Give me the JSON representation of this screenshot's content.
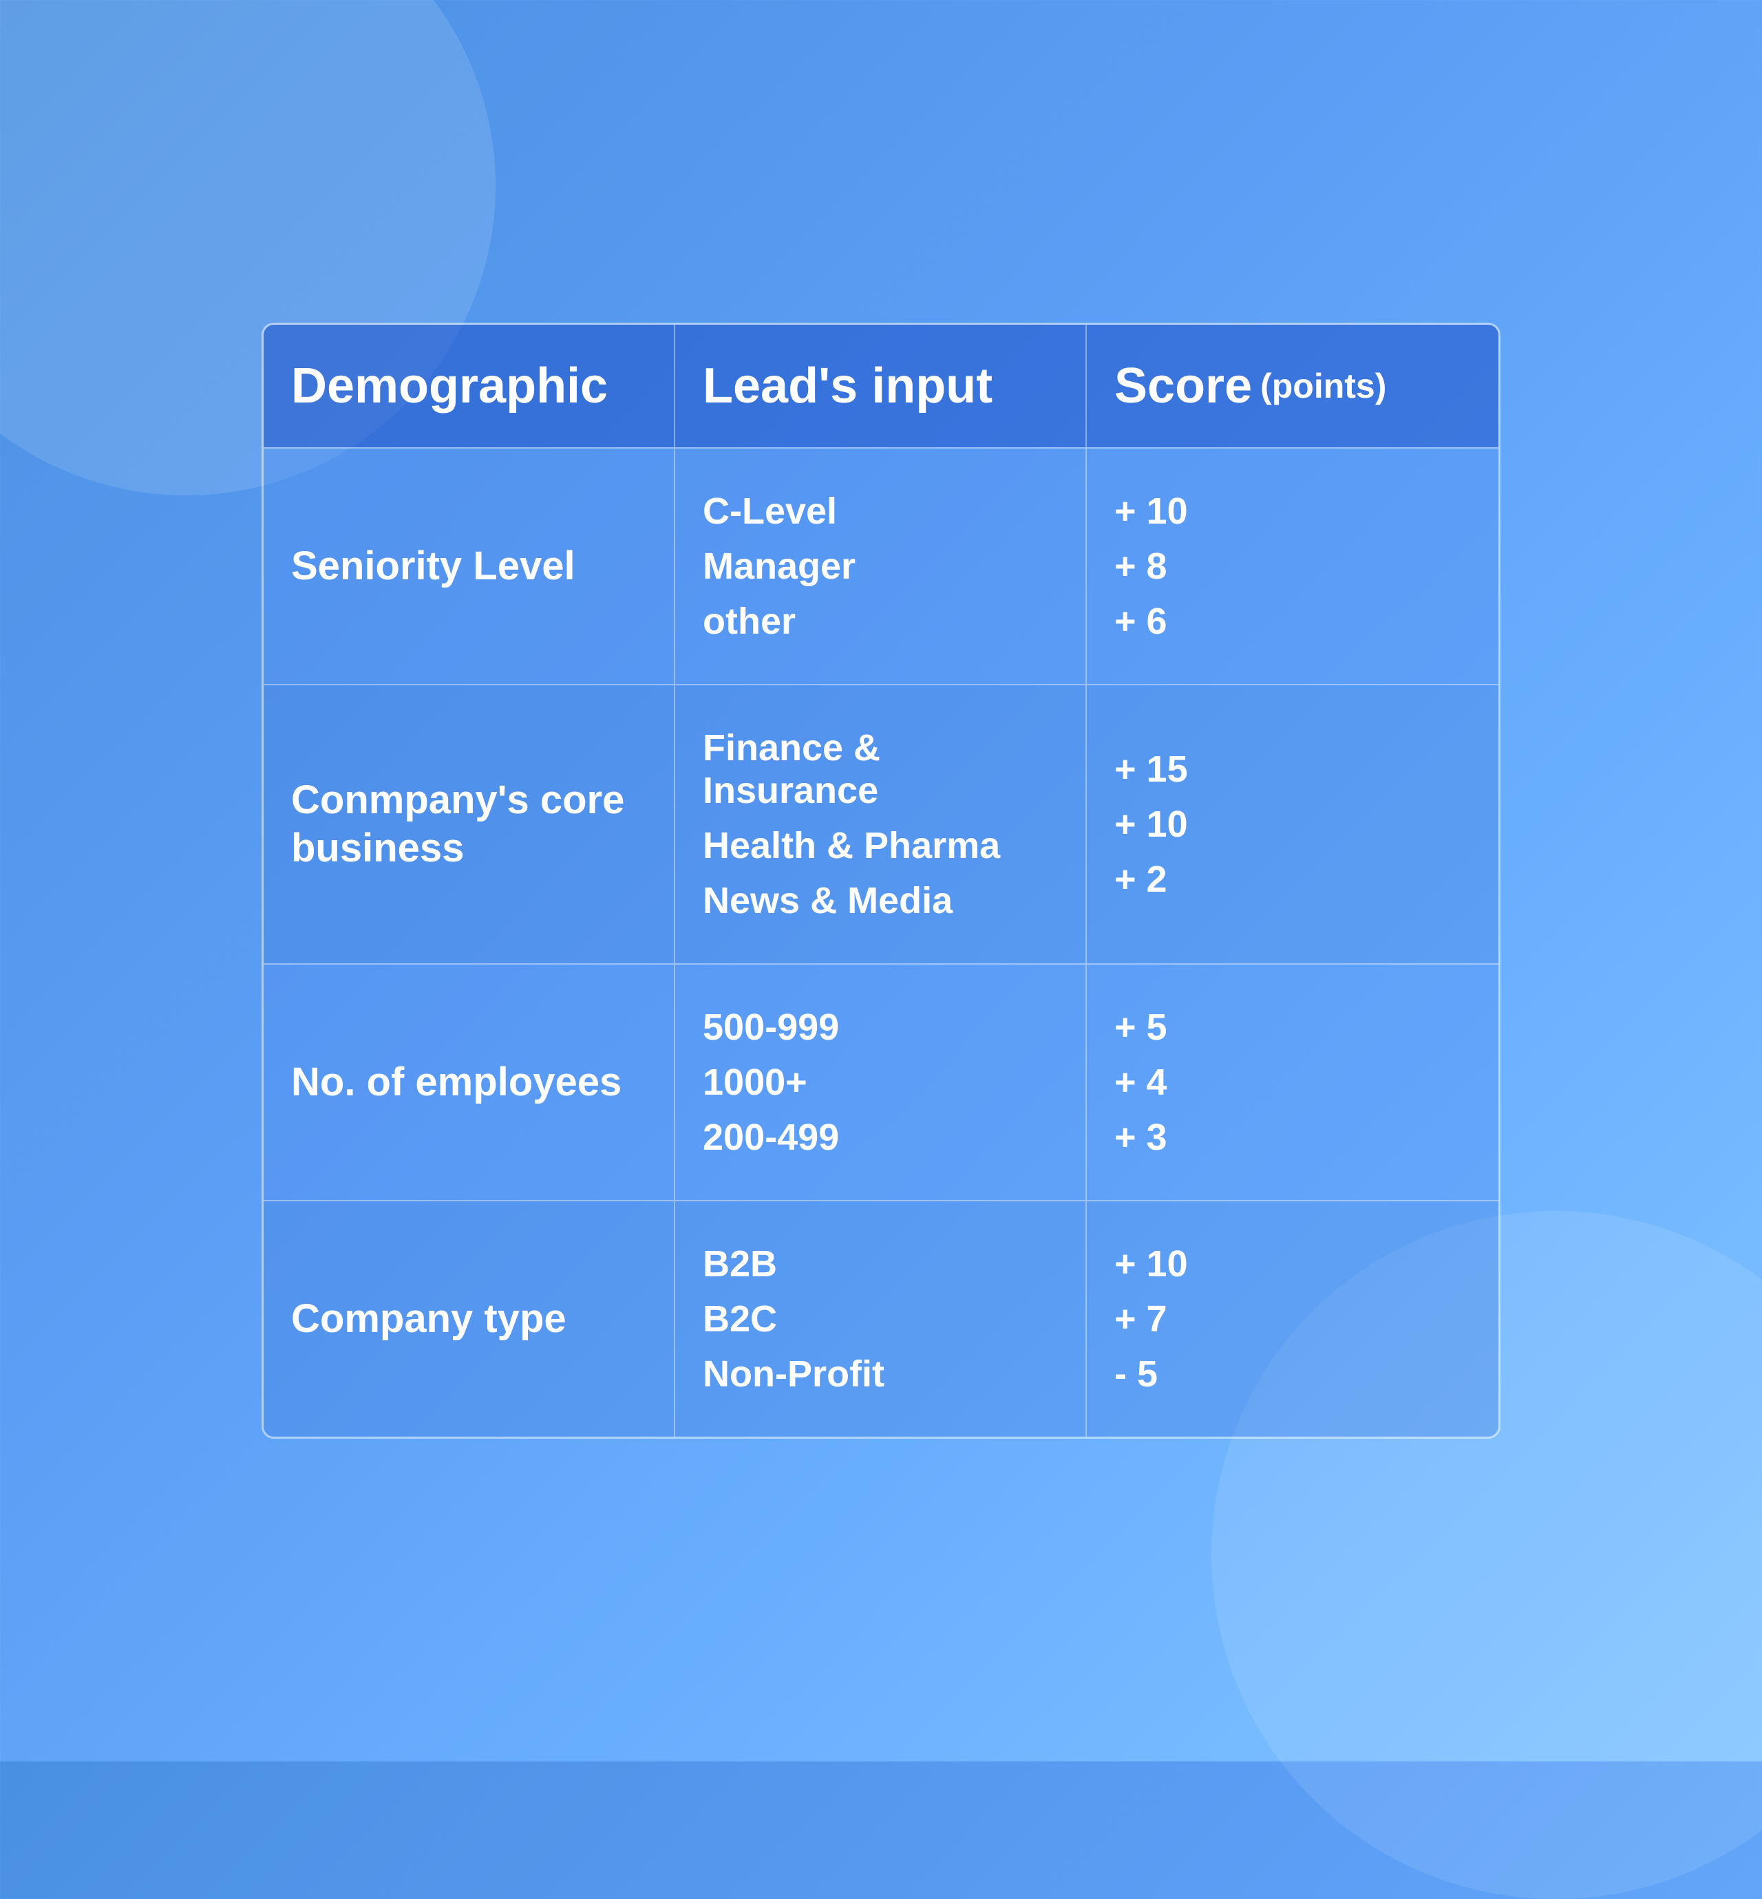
{
  "header": {
    "col1": "Demographic",
    "col2": "Lead's input",
    "col3": "Score",
    "col3_sub": "(points)"
  },
  "rows": [
    {
      "label": "Seniority Level",
      "inputs": [
        "C-Level",
        "Manager",
        "other"
      ],
      "scores": [
        "+ 10",
        "+ 8",
        "+ 6"
      ]
    },
    {
      "label": "Conmpany's core business",
      "inputs": [
        "Finance & Insurance",
        "Health & Pharma",
        "News & Media"
      ],
      "scores": [
        "+ 15",
        "+ 10",
        "+ 2"
      ]
    },
    {
      "label": "No. of employees",
      "inputs": [
        "500-999",
        "1000+",
        "200-499"
      ],
      "scores": [
        "+ 5",
        "+ 4",
        "+ 3"
      ]
    },
    {
      "label": "Company type",
      "inputs": [
        "B2B",
        "B2C",
        "Non-Profit"
      ],
      "scores": [
        "+ 10",
        "+ 7",
        "- 5"
      ]
    }
  ]
}
